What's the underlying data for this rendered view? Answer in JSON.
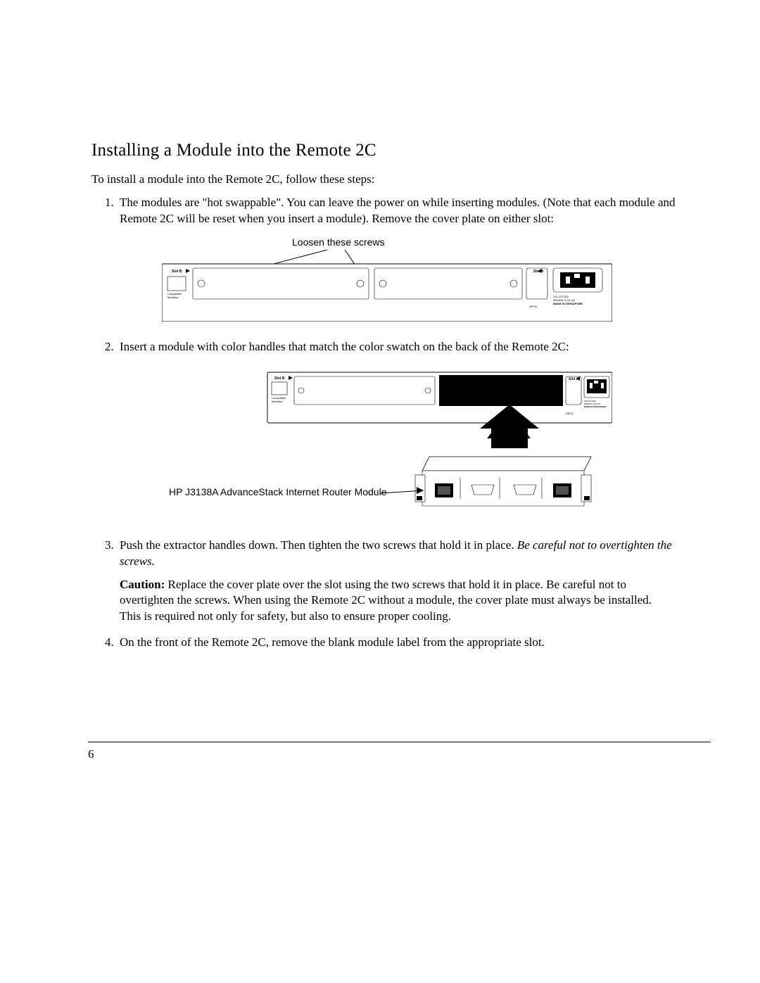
{
  "heading": "Installing a Module into the Remote 2C",
  "lead": "To install a module into the Remote 2C, follow these steps:",
  "steps": {
    "s1": "The modules are \"hot swappable\". You can leave the power on while inserting modules. (Note that each module and Remote 2C will be reset when you insert a module). Remove the cover plate on either slot:",
    "s2": "Insert a module with color handles that match the color swatch on the back of the Remote 2C:",
    "s3_a": "Push the extractor handles down. Then tighten the two screws that hold it in place. ",
    "s3_b": "Be careful not to overtighten the screws.",
    "s3_caution_label": "Caution: ",
    "s3_caution_body": "Replace the cover plate over the slot using the two screws that hold it in place. Be careful not to overtighten the screws. When using the Remote 2C without a module, the cover plate must always be installed. This is required not only for safety, but also to ensure proper cooling.",
    "s4": "On the front of the Remote 2C, remove the blank module label from the appropriate slot."
  },
  "figure1": {
    "callout": "Loosen these screws",
    "slot_b": "Slot B",
    "slot_a": "Slot A",
    "compat": "Compatible\nModules:",
    "rps": "(RPS)",
    "power_spec": "100-127/200\n50/60Hz 2.0/1.0A\nMADE IN SINGAPORE"
  },
  "figure2": {
    "module_label": "HP J3138A AdvanceStack Internet Router Module",
    "slot_b": "Slot B",
    "slot_a": "Slot A",
    "compat": "Compatible\nModules:",
    "rps": "(RPS)",
    "power_spec": "100-127/200\n50/60Hz 2.0/1.0A\nMADE IN SINGAPORE"
  },
  "page_number": "6"
}
